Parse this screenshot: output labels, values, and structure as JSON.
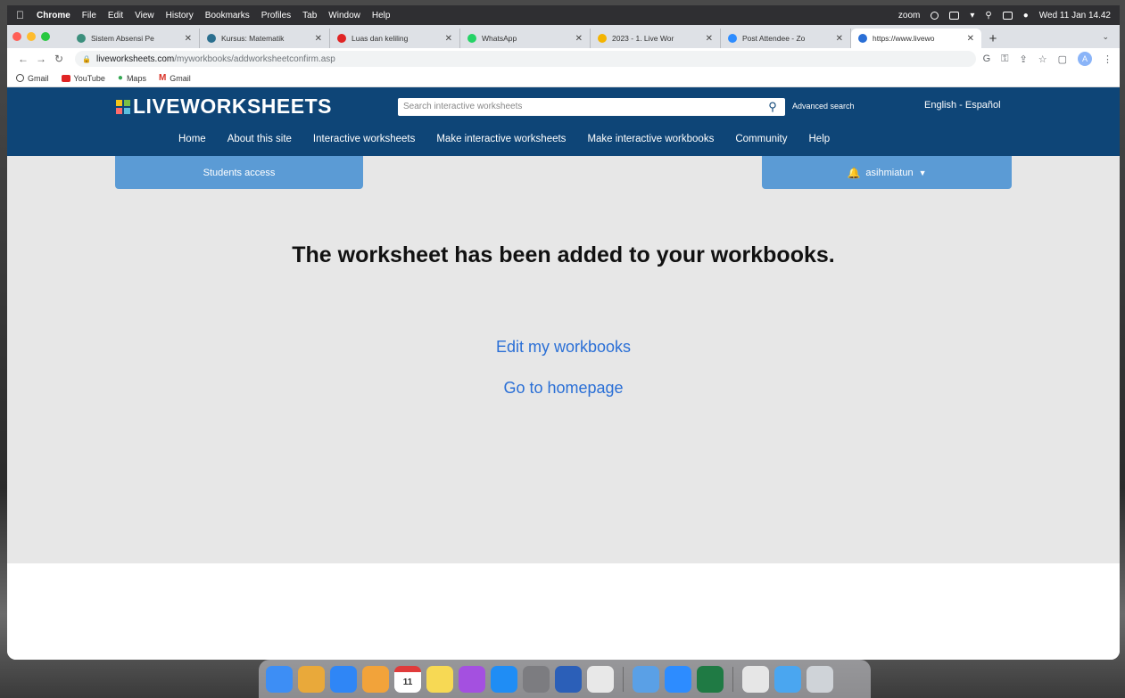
{
  "menubar": {
    "app_name": "Chrome",
    "items": [
      "File",
      "Edit",
      "View",
      "History",
      "Bookmarks",
      "Profiles",
      "Tab",
      "Window",
      "Help"
    ],
    "zoom_label": "zoom",
    "clock": "Wed 11 Jan 14.42"
  },
  "tabs": [
    {
      "label": "Sistem Absensi Pe",
      "favicon_color": "#3c8f7d"
    },
    {
      "label": "Kursus: Matematik",
      "favicon_color": "#2b6f8f"
    },
    {
      "label": "Luas dan keliling",
      "favicon_color": "#e02424"
    },
    {
      "label": "WhatsApp",
      "favicon_color": "#25d366"
    },
    {
      "label": "2023 - 1. Live Wor",
      "favicon_color": "#f4b400"
    },
    {
      "label": "Post Attendee - Zo",
      "favicon_color": "#2d8cff"
    },
    {
      "label": "https://www.livewo",
      "favicon_color": "#2a6fd6"
    }
  ],
  "address": {
    "host": "liveworksheets.com",
    "path": "/myworkbooks/addworksheetconfirm.asp"
  },
  "bookmarks": [
    {
      "label": "Gmail",
      "color": "#444444"
    },
    {
      "label": "YouTube",
      "color": "#e02424"
    },
    {
      "label": "Maps",
      "color": "#34a853"
    },
    {
      "label": "Gmail",
      "color": "#d93025"
    }
  ],
  "site": {
    "logo": "LIVEWORKSHEETS",
    "search_placeholder": "Search interactive worksheets",
    "advanced_search": "Advanced search",
    "language": "English - Español",
    "nav": [
      "Home",
      "About this site",
      "Interactive worksheets",
      "Make interactive worksheets",
      "Make interactive workbooks",
      "Community",
      "Help"
    ],
    "students_access": "Students access",
    "username": "asihmiatun",
    "brand_color": "#0e4577",
    "panel_color": "#5b9bd5"
  },
  "content": {
    "message": "The worksheet has been added to your workbooks.",
    "link_edit": "Edit my workbooks",
    "link_home": "Go to homepage",
    "link_color": "#2a6fd6"
  },
  "dock": {
    "calendar_day": "11",
    "apps": [
      {
        "name": "finder-icon",
        "color": "#3d8ef5"
      },
      {
        "name": "launchpad-icon",
        "color": "#e9a93a"
      },
      {
        "name": "safari-icon",
        "color": "#2f86f6"
      },
      {
        "name": "photos-icon",
        "color": "#f2a33a"
      },
      {
        "name": "calendar-icon",
        "color": "#ffffff"
      },
      {
        "name": "notes-icon",
        "color": "#f7d954"
      },
      {
        "name": "podcasts-icon",
        "color": "#a450e0"
      },
      {
        "name": "app-store-icon",
        "color": "#1f8df5"
      },
      {
        "name": "system-preferences-icon",
        "color": "#7c7c80"
      },
      {
        "name": "word-icon",
        "color": "#2b5fb8"
      },
      {
        "name": "chrome-icon",
        "color": "#e8e8e8"
      },
      {
        "name": "preview-icon",
        "color": "#5aa0e6"
      },
      {
        "name": "zoom-icon",
        "color": "#2d8cff"
      },
      {
        "name": "excel-icon",
        "color": "#1f7a44"
      },
      {
        "name": "downloads-icon",
        "color": "#e6e6e6"
      },
      {
        "name": "folder-icon",
        "color": "#4aa6f0"
      },
      {
        "name": "trash-icon",
        "color": "#cfd3d8"
      }
    ]
  }
}
